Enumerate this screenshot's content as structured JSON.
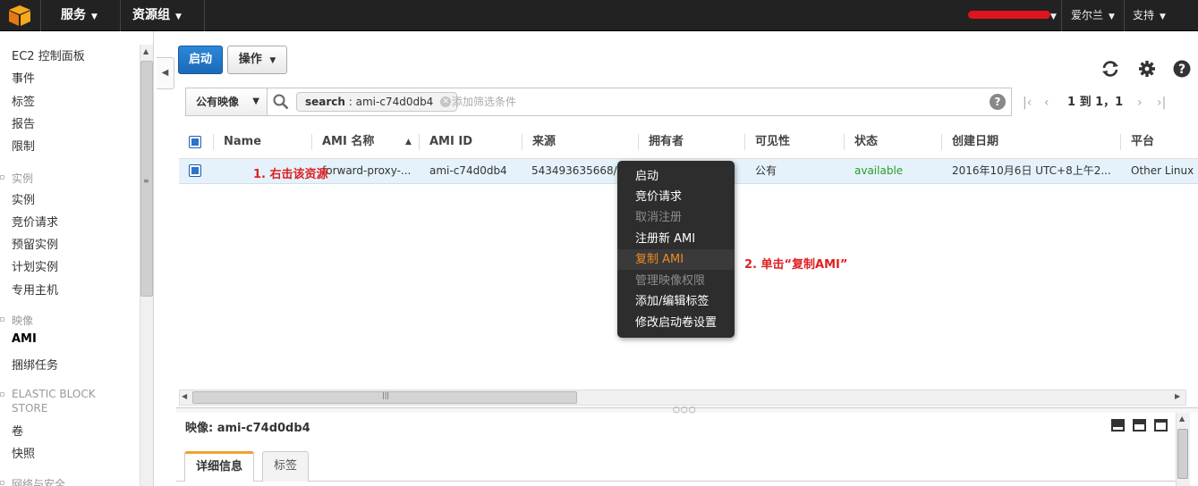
{
  "topbar": {
    "services": "服务",
    "resource_groups": "资源组",
    "region": "爱尔兰",
    "support": "支持",
    "redacted_color": "#e0141e"
  },
  "sidebar": {
    "items_top": [
      "EC2 控制面板",
      "事件",
      "标签",
      "报告",
      "限制"
    ],
    "section_instances": "实例",
    "items_instances": [
      "实例",
      "竞价请求",
      "预留实例",
      "计划实例",
      "专用主机"
    ],
    "section_images": "映像",
    "items_images": [
      "AMI",
      "捆绑任务"
    ],
    "section_ebs_line1": "ELASTIC BLOCK",
    "section_ebs_line2": "STORE",
    "items_ebs": [
      "卷",
      "快照"
    ],
    "section_network": "网络与安全"
  },
  "toolbar": {
    "launch": "启动",
    "actions": "操作"
  },
  "filter": {
    "select_value": "公有映像",
    "token_key": "search",
    "token_value": "ami-c74d0db4",
    "placeholder": "添加筛选条件",
    "pager_text": "1 到 1，1"
  },
  "table": {
    "columns": [
      "Name",
      "AMI 名称",
      "AMI ID",
      "来源",
      "拥有者",
      "可见性",
      "状态",
      "创建日期",
      "平台"
    ],
    "row": {
      "name": "",
      "ami_name": "forward-proxy-...",
      "ami_id": "ami-c74d0db4",
      "source": "543493635668/f...",
      "owner": "",
      "visibility": "公有",
      "status": "available",
      "created": "2016年10月6日 UTC+8上午2...",
      "platform": "Other Linux"
    }
  },
  "annotations": {
    "step1": "1. 右击该资源",
    "step2": "2. 单击“复制AMI”"
  },
  "context_menu": [
    {
      "label": "启动",
      "state": "enabled"
    },
    {
      "label": "竞价请求",
      "state": "enabled"
    },
    {
      "label": "取消注册",
      "state": "disabled"
    },
    {
      "label": "注册新 AMI",
      "state": "enabled"
    },
    {
      "label": "复制 AMI",
      "state": "highlighted"
    },
    {
      "label": "管理映像权限",
      "state": "disabled"
    },
    {
      "label": "添加/编辑标签",
      "state": "enabled"
    },
    {
      "label": "修改启动卷设置",
      "state": "enabled"
    }
  ],
  "detail": {
    "title": "映像: ami-c74d0db4",
    "tabs": [
      "详细信息",
      "标签"
    ]
  },
  "colors": {
    "launch_button": "#1a6ab8",
    "status_available": "#2a9d2a",
    "menu_highlight": "#f08a24",
    "annotation": "#e02020"
  }
}
